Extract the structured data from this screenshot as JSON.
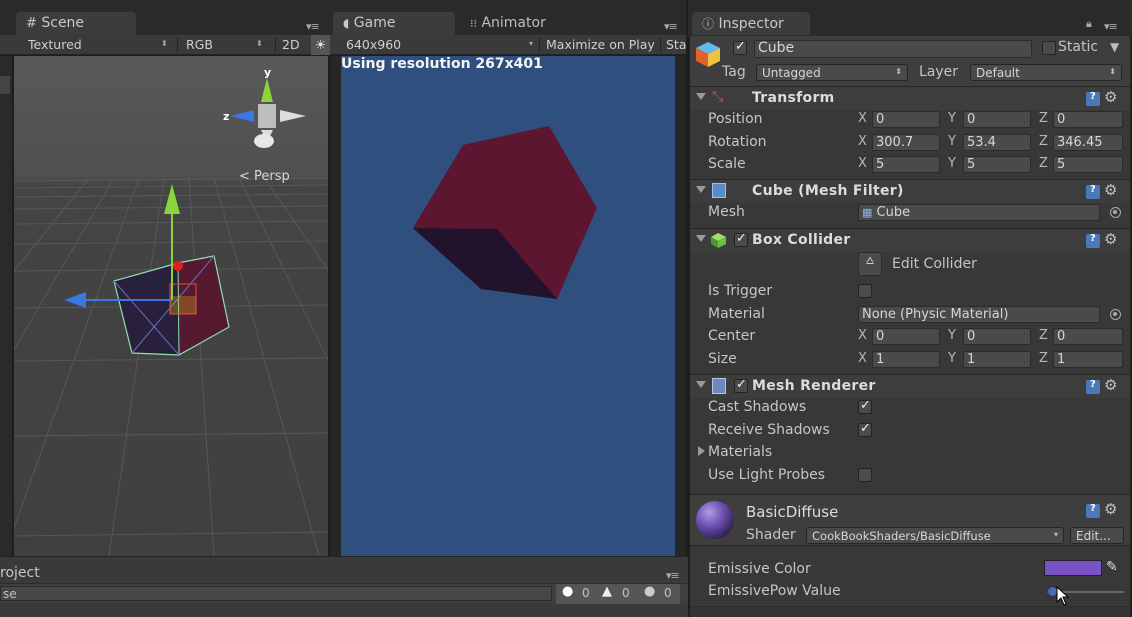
{
  "scene_panel": {
    "tab_label": "Scene",
    "render_mode": "Textured",
    "color_mode": "RGB",
    "toggle_2d": "2D",
    "persp_label": "Persp",
    "gizmo_axes": {
      "y": "y",
      "z": "z"
    }
  },
  "game_panel": {
    "tab_label": "Game",
    "animator_tab_label": "Animator",
    "resolution": "640x960",
    "maximize_label": "Maximize on Play",
    "stats_label": "Sta",
    "overlay_text": "Using resolution 267x401"
  },
  "project_panel": {
    "tab_label": "roject",
    "search_text": "se",
    "counts": {
      "errors": "0",
      "warnings": "0",
      "messages": "0"
    }
  },
  "inspector": {
    "tab_label": "Inspector",
    "object_name": "Cube",
    "static_label": "Static",
    "tag_label": "Tag",
    "tag_value": "Untagged",
    "layer_label": "Layer",
    "layer_value": "Default",
    "transform": {
      "title": "Transform",
      "position_label": "Position",
      "rotation_label": "Rotation",
      "scale_label": "Scale",
      "position": {
        "x": "0",
        "y": "0",
        "z": "0"
      },
      "rotation": {
        "x": "300.7",
        "y": "53.4",
        "z": "346.45"
      },
      "scale": {
        "x": "5",
        "y": "5",
        "z": "5"
      }
    },
    "mesh_filter": {
      "title": "Cube (Mesh Filter)",
      "mesh_label": "Mesh",
      "mesh_value": "Cube"
    },
    "box_collider": {
      "title": "Box Collider",
      "edit_collider": "Edit Collider",
      "is_trigger_label": "Is Trigger",
      "material_label": "Material",
      "material_value": "None (Physic Material)",
      "center_label": "Center",
      "size_label": "Size",
      "center": {
        "x": "0",
        "y": "0",
        "z": "0"
      },
      "size": {
        "x": "1",
        "y": "1",
        "z": "1"
      }
    },
    "mesh_renderer": {
      "title": "Mesh Renderer",
      "cast_shadows_label": "Cast Shadows",
      "receive_shadows_label": "Receive Shadows",
      "materials_label": "Materials",
      "use_light_probes_label": "Use Light Probes",
      "cast_shadows": true,
      "receive_shadows": true,
      "use_light_probes": false
    },
    "material": {
      "name": "BasicDiffuse",
      "shader_label": "Shader",
      "shader_value": "CookBookShaders/BasicDiffuse",
      "edit_button": "Edit...",
      "emissive_color_label": "Emissive Color",
      "emissive_color": "#7a52c8",
      "emissive_pow_label": "EmissivePow Value",
      "emissive_pow": 0.02
    },
    "axis_labels": {
      "x": "X",
      "y": "Y",
      "z": "Z"
    }
  },
  "colors": {
    "scene_bg": "#474747",
    "game_bg": "#2f4f7f",
    "cube_face": "#5c1630",
    "cube_shadow": "#22132d"
  }
}
